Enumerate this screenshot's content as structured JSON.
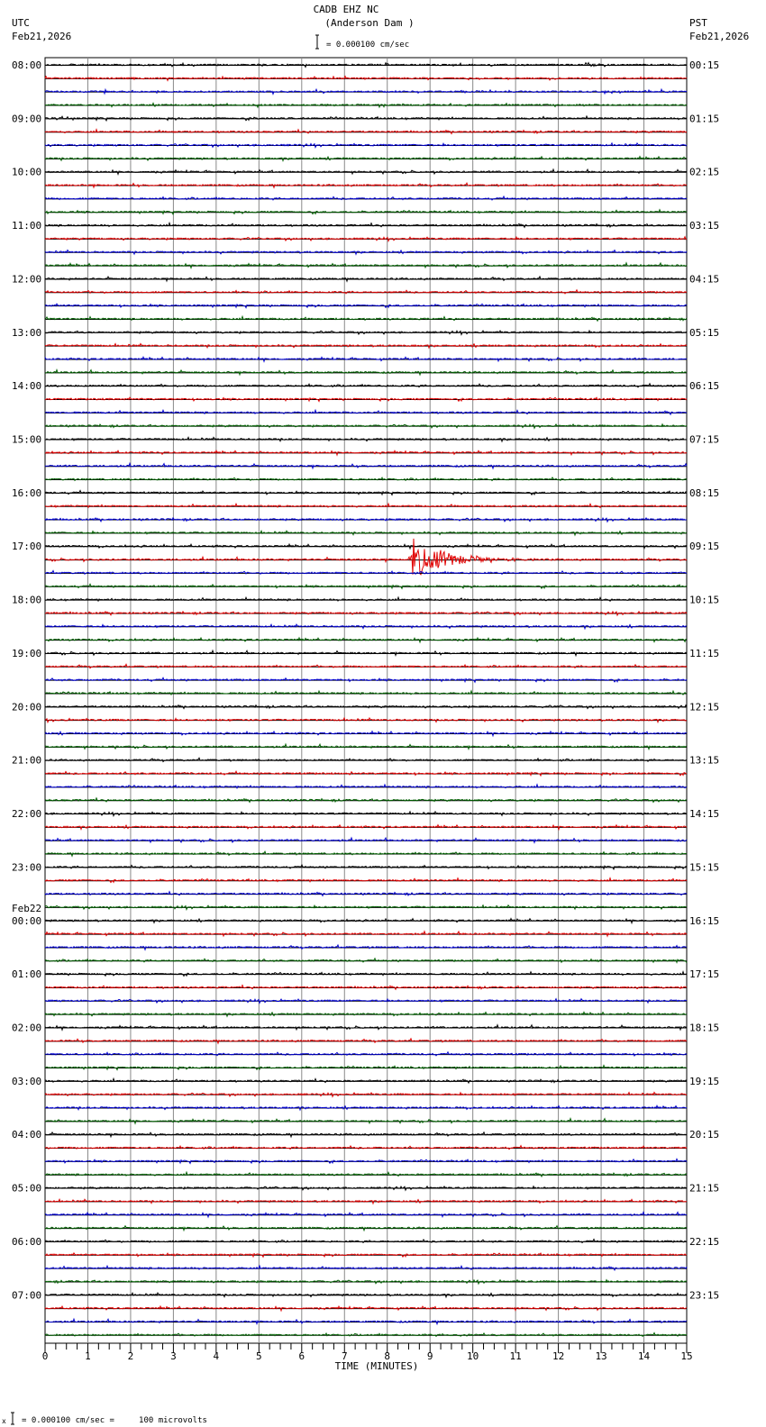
{
  "header": {
    "station": "CADB EHZ NC",
    "location": "(Anderson Dam )",
    "scale_text": "= 0.000100 cm/sec",
    "left_tz": "UTC",
    "left_date": "Feb21,2026",
    "right_tz": "PST",
    "right_date": "Feb21,2026"
  },
  "footer": {
    "scale_text": "= 0.000100 cm/sec =     100 microvolts",
    "mark": "x"
  },
  "chart_data": {
    "type": "line",
    "title": "CADB EHZ NC (Anderson Dam )",
    "xlabel": "TIME (MINUTES)",
    "xlim": [
      0,
      15
    ],
    "xticks": [
      "0",
      "1",
      "2",
      "3",
      "4",
      "5",
      "6",
      "7",
      "8",
      "9",
      "10",
      "11",
      "12",
      "13",
      "14",
      "15"
    ],
    "minor_tick_step_minutes": 0.25,
    "grid": true,
    "traces_per_hour": 4,
    "trace_colors": [
      "#000000",
      "#e00000",
      "#0000d0",
      "#006000"
    ],
    "left_labels": [
      "08:00",
      "09:00",
      "10:00",
      "11:00",
      "12:00",
      "13:00",
      "14:00",
      "15:00",
      "16:00",
      "17:00",
      "18:00",
      "19:00",
      "20:00",
      "21:00",
      "22:00",
      "23:00",
      "00:00",
      "01:00",
      "02:00",
      "03:00",
      "04:00",
      "05:00",
      "06:00",
      "07:00"
    ],
    "date_change_label": "Feb22",
    "date_change_hour_index": 16,
    "right_labels": [
      "00:15",
      "01:15",
      "02:15",
      "03:15",
      "04:15",
      "05:15",
      "06:15",
      "07:15",
      "08:15",
      "09:15",
      "10:15",
      "11:15",
      "12:15",
      "13:15",
      "14:15",
      "15:15",
      "16:15",
      "17:15",
      "18:15",
      "19:15",
      "20:15",
      "21:15",
      "22:15",
      "23:15"
    ],
    "events": [
      {
        "trace": 37,
        "start_min": 8.5,
        "peak_amplitude": 1.0,
        "duration_min": 3.0
      },
      {
        "trace": 4,
        "start_min": 4.8,
        "peak_amplitude": 0.15,
        "duration_min": 0.3
      },
      {
        "trace": 53,
        "start_min": 6.8,
        "peak_amplitude": 0.12,
        "duration_min": 0.3
      },
      {
        "trace": 95,
        "start_min": 9.6,
        "peak_amplitude": 0.15,
        "duration_min": 0.6
      }
    ]
  }
}
